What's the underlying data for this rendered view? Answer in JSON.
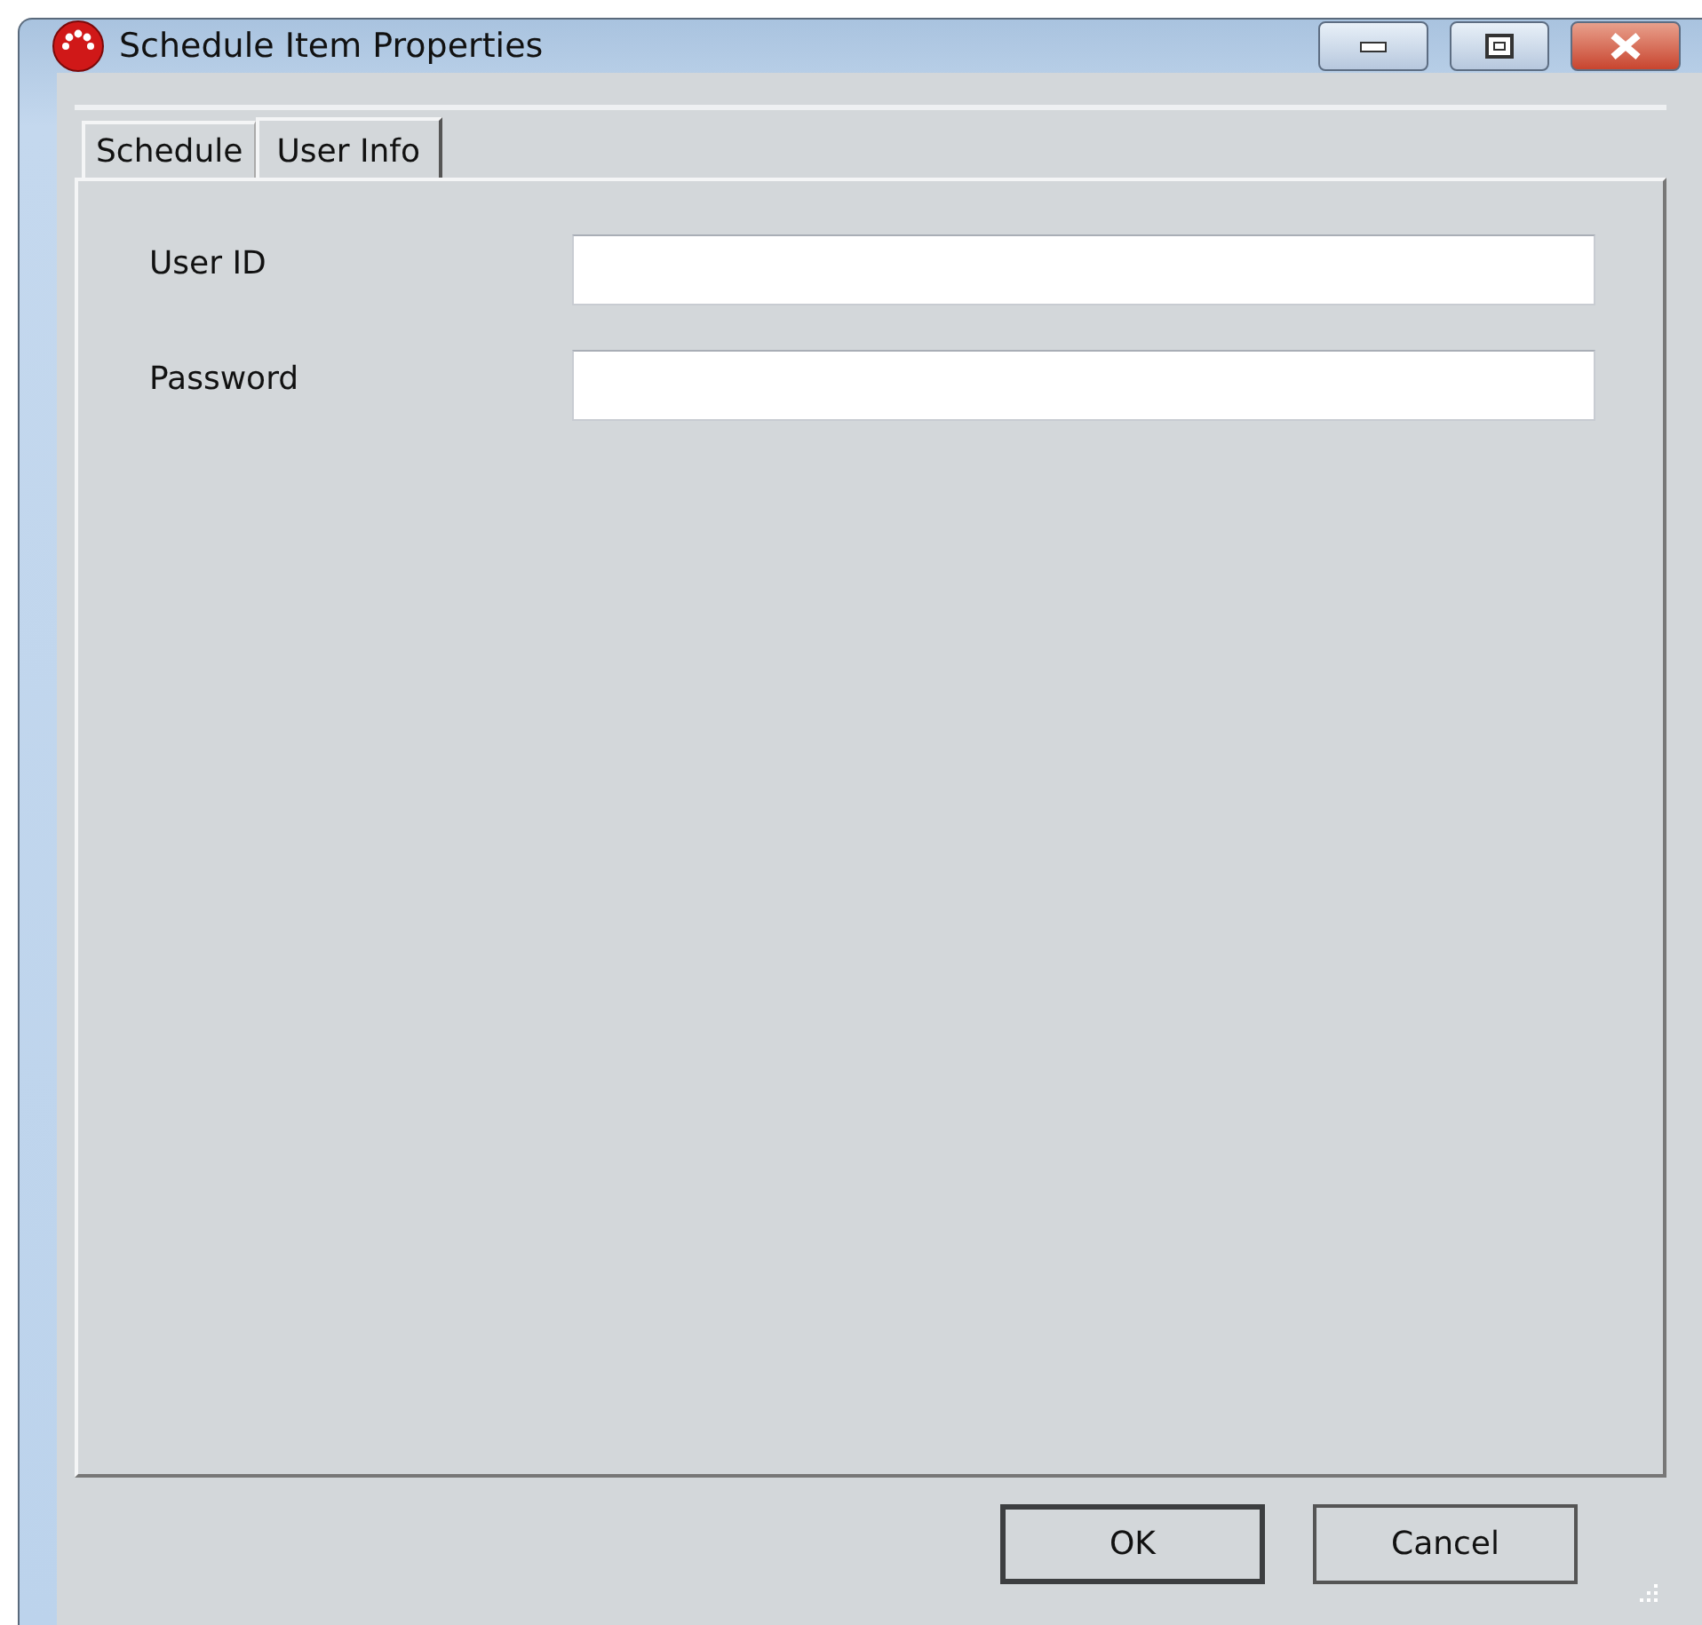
{
  "window": {
    "title": "Schedule Item Properties"
  },
  "tabs": [
    {
      "label": "Schedule",
      "selected": false
    },
    {
      "label": "User Info",
      "selected": true
    }
  ],
  "fields": [
    {
      "label": "User ID"
    },
    {
      "label": "Password"
    }
  ],
  "buttons": [
    {
      "label": "OK",
      "default": true
    },
    {
      "label": "Cancel",
      "default": false
    }
  ]
}
